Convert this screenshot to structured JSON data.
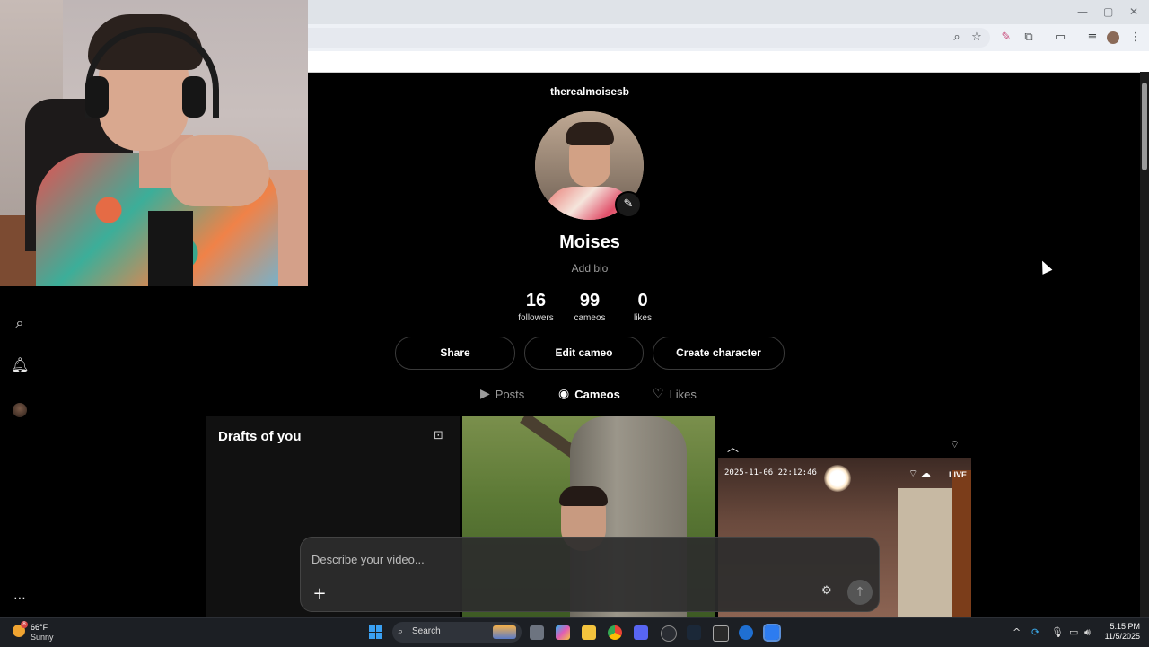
{
  "profile": {
    "username": "therealmoisesb",
    "display_name": "Moises",
    "bio_placeholder": "Add bio",
    "stats": [
      {
        "value": "16",
        "label": "followers"
      },
      {
        "value": "99",
        "label": "cameos"
      },
      {
        "value": "0",
        "label": "likes"
      }
    ],
    "actions": {
      "share": "Share",
      "edit_cameo": "Edit cameo",
      "create_character": "Create character"
    },
    "tabs": [
      {
        "label": "Posts",
        "icon": "play-icon",
        "active": false
      },
      {
        "label": "Cameos",
        "icon": "person-circle-icon",
        "active": true
      },
      {
        "label": "Likes",
        "icon": "heart-icon",
        "active": false
      }
    ]
  },
  "grid": {
    "drafts_title": "Drafts of you",
    "tile3_timestamp": "2025-11-06 22:12:46",
    "tile3_live": "LIVE"
  },
  "composer": {
    "placeholder": "Describe your video..."
  },
  "sidebar": {
    "icons": [
      "search-icon",
      "bell-icon",
      "avatar",
      "more-icon"
    ]
  },
  "taskbar": {
    "weather_temp": "66°F",
    "weather_condition": "Sunny",
    "weather_badge": "8",
    "search_label": "Search",
    "time": "5:15 PM",
    "date": "11/5/2025"
  },
  "colors": {
    "background": "#000000",
    "accent_blue": "#3aa0f2",
    "muted_text": "#9b9b9b"
  }
}
